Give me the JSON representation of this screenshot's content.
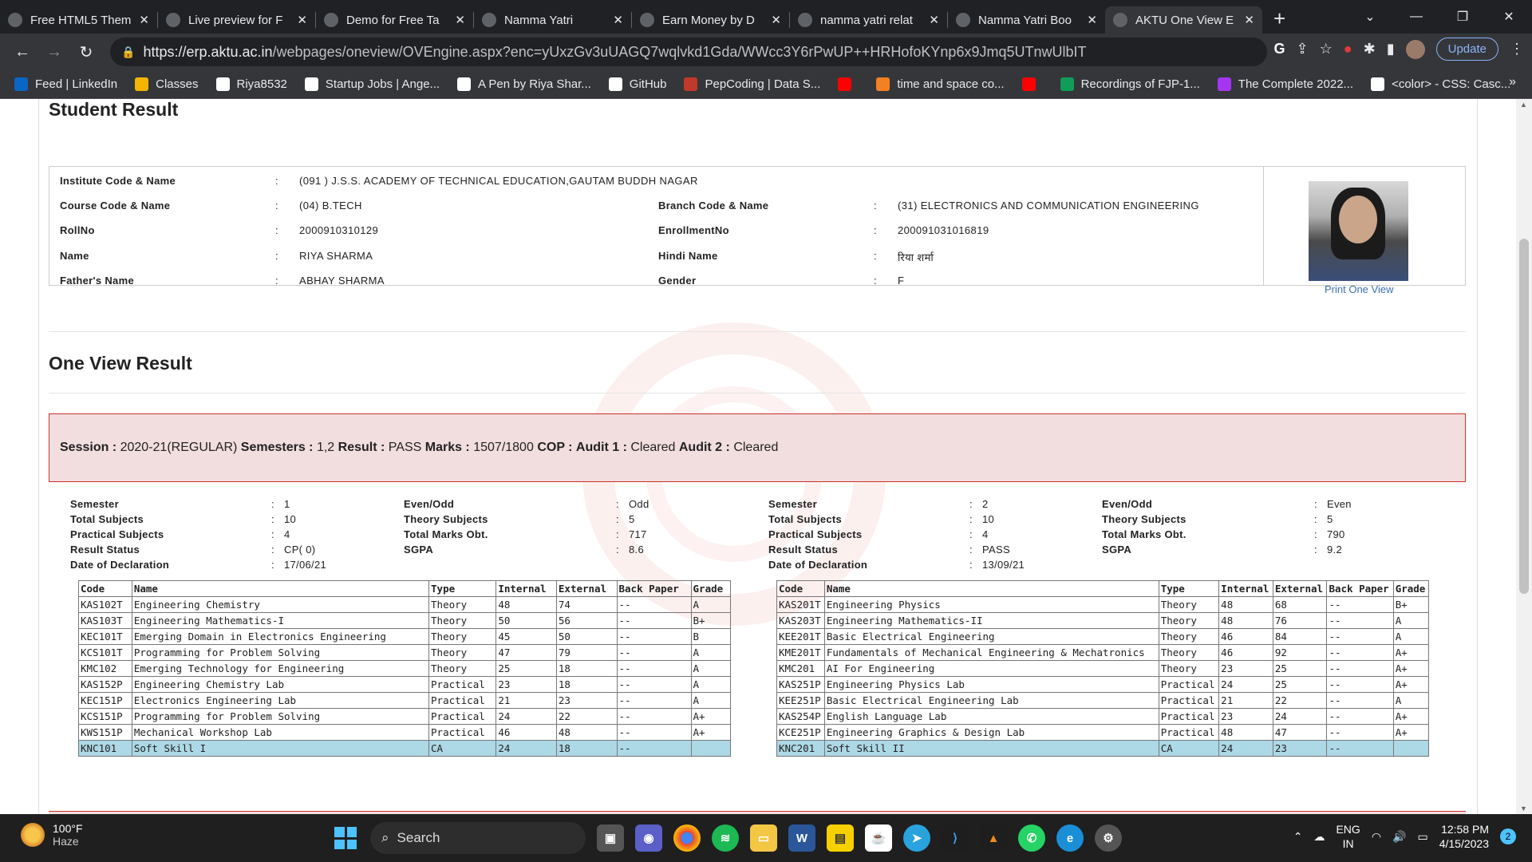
{
  "browser": {
    "tabs": [
      {
        "title": "Free HTML5 Them",
        "icon": "theme-icon",
        "active": false
      },
      {
        "title": "Live preview for F",
        "icon": "theme-icon",
        "active": false
      },
      {
        "title": "Demo for Free Ta",
        "icon": "theme-icon",
        "active": false
      },
      {
        "title": "Namma Yatri",
        "icon": "loading-icon",
        "active": false
      },
      {
        "title": "Earn Money by D",
        "icon": "page-icon",
        "active": false
      },
      {
        "title": "namma yatri relat",
        "icon": "google-icon",
        "active": false
      },
      {
        "title": "Namma Yatri Boo",
        "icon": "globe-icon",
        "active": false
      },
      {
        "title": "AKTU One View E",
        "icon": "aktu-icon",
        "active": true
      }
    ],
    "url_host": "https://erp.aktu.ac.in",
    "url_path": "/webpages/oneview/OVEngine.aspx?enc=yUxzGv3uUAGQ7wqlvkd1Gda/WWcc3Y6rPwUP++HRHofoKYnp6x9Jmq5UTnwUlbIT",
    "update_label": "Update",
    "bookmarks": [
      {
        "label": "Feed | LinkedIn",
        "icon": "linkedin-icon",
        "color": "#0a66c2"
      },
      {
        "label": "Classes",
        "icon": "classroom-icon",
        "color": "#f4b400"
      },
      {
        "label": "Riya8532",
        "icon": "github-icon",
        "color": "#ffffff"
      },
      {
        "label": "Startup Jobs | Ange...",
        "icon": "angellist-icon",
        "color": "#ffffff"
      },
      {
        "label": "A Pen by Riya Shar...",
        "icon": "codepen-icon",
        "color": "#ffffff"
      },
      {
        "label": "GitHub",
        "icon": "github-icon",
        "color": "#ffffff"
      },
      {
        "label": "PepCoding | Data S...",
        "icon": "pepcoding-icon",
        "color": "#c0392b"
      },
      {
        "label": "",
        "icon": "youtube-icon",
        "color": "#ff0000"
      },
      {
        "label": "time and space co...",
        "icon": "stackoverflow-icon",
        "color": "#f48024"
      },
      {
        "label": "",
        "icon": "youtube-icon",
        "color": "#ff0000"
      },
      {
        "label": "Recordings of FJP-1...",
        "icon": "sheets-icon",
        "color": "#0f9d58"
      },
      {
        "label": "The Complete 2022...",
        "icon": "udemy-icon",
        "color": "#a435f0"
      },
      {
        "label": "<color> - CSS: Casc...",
        "icon": "mdn-icon",
        "color": "#ffffff"
      }
    ]
  },
  "student": {
    "section_title": "Student Result",
    "institute_label": "Institute Code & Name",
    "institute_value": "(091 ) J.S.S. ACADEMY OF TECHNICAL EDUCATION,GAUTAM BUDDH NAGAR",
    "course_label": "Course Code & Name",
    "course_value": "(04) B.TECH",
    "branch_label": "Branch Code & Name",
    "branch_value": "(31) ELECTRONICS AND COMMUNICATION ENGINEERING",
    "roll_label": "RollNo",
    "roll_value": "2000910310129",
    "enroll_label": "EnrollmentNo",
    "enroll_value": "200091031016819",
    "name_label": "Name",
    "name_value": "RIYA SHARMA",
    "hindi_label": "Hindi Name",
    "hindi_value": "रिया शर्मा",
    "father_label": "Father's Name",
    "father_value": "ABHAY SHARMA",
    "gender_label": "Gender",
    "gender_value": "F",
    "print_link": "Print One View"
  },
  "oneview": {
    "title": "One View Result",
    "session_label": "Session :",
    "session_value": "2020-21(REGULAR)",
    "semesters_label": "Semesters :",
    "semesters_value": "1,2",
    "result_label": "Result :",
    "result_value": "PASS",
    "marks_label": "Marks :",
    "marks_value": "1507/1800",
    "cop_label": "COP :",
    "audit1_label": "Audit 1 :",
    "audit1_value": "Cleared",
    "audit2_label": "Audit 2 :",
    "audit2_value": "Cleared"
  },
  "semester_labels": {
    "semester": "Semester",
    "total_subjects": "Total Subjects",
    "practical_subjects": "Practical Subjects",
    "result_status": "Result Status",
    "date_of_declaration": "Date of Declaration",
    "even_odd": "Even/Odd",
    "theory_subjects": "Theory Subjects",
    "total_marks": "Total Marks Obt.",
    "sgpa": "SGPA"
  },
  "semesters": [
    {
      "semester": "1",
      "total_subjects": "10",
      "practical_subjects": "4",
      "result_status": "CP( 0)",
      "date": "17/06/21",
      "even_odd": "Odd",
      "theory_subjects": "5",
      "total_marks": "717",
      "sgpa": "8.6"
    },
    {
      "semester": "2",
      "total_subjects": "10",
      "practical_subjects": "4",
      "result_status": "PASS",
      "date": "13/09/21",
      "even_odd": "Even",
      "theory_subjects": "5",
      "total_marks": "790",
      "sgpa": "9.2"
    }
  ],
  "table_headers": [
    "Code",
    "Name",
    "Type",
    "Internal",
    "External",
    "Back Paper",
    "Grade"
  ],
  "sem1_rows": [
    [
      "KAS102T",
      "Engineering Chemistry",
      "Theory",
      "48",
      "74",
      "--",
      "A"
    ],
    [
      "KAS103T",
      "Engineering Mathematics-I",
      "Theory",
      "50",
      "56",
      "--",
      "B+"
    ],
    [
      "KEC101T",
      "Emerging Domain in Electronics Engineering",
      "Theory",
      "45",
      "50",
      "--",
      "B"
    ],
    [
      "KCS101T",
      "Programming for Problem Solving",
      "Theory",
      "47",
      "79",
      "--",
      "A"
    ],
    [
      "KMC102",
      "Emerging Technology for Engineering",
      "Theory",
      "25",
      "18",
      "--",
      "A"
    ],
    [
      "KAS152P",
      "Engineering Chemistry Lab",
      "Practical",
      "23",
      "18",
      "--",
      "A"
    ],
    [
      "KEC151P",
      "Electronics Engineering Lab",
      "Practical",
      "21",
      "23",
      "--",
      "A"
    ],
    [
      "KCS151P",
      "Programming for Problem Solving",
      "Practical",
      "24",
      "22",
      "--",
      "A+"
    ],
    [
      "KWS151P",
      "Mechanical Workshop Lab",
      "Practical",
      "46",
      "48",
      "--",
      "A+"
    ],
    [
      "KNC101",
      "Soft Skill I",
      "CA",
      "24",
      "18",
      "--",
      ""
    ]
  ],
  "sem2_rows": [
    [
      "KAS201T",
      "Engineering Physics",
      "Theory",
      "48",
      "68",
      "--",
      "B+"
    ],
    [
      "KAS203T",
      "Engineering Mathematics-II",
      "Theory",
      "48",
      "76",
      "--",
      "A"
    ],
    [
      "KEE201T",
      "Basic Electrical Engineering",
      "Theory",
      "46",
      "84",
      "--",
      "A"
    ],
    [
      "KME201T",
      "Fundamentals of Mechanical Engineering & Mechatronics",
      "Theory",
      "46",
      "92",
      "--",
      "A+"
    ],
    [
      "KMC201",
      "AI For Engineering",
      "Theory",
      "23",
      "25",
      "--",
      "A+"
    ],
    [
      "KAS251P",
      "Engineering Physics Lab",
      "Practical",
      "24",
      "25",
      "--",
      "A+"
    ],
    [
      "KEE251P",
      "Basic Electrical Engineering Lab",
      "Practical",
      "21",
      "22",
      "--",
      "A"
    ],
    [
      "KAS254P",
      "English Language Lab",
      "Practical",
      "23",
      "24",
      "--",
      "A+"
    ],
    [
      "KCE251P",
      "Engineering Graphics & Design Lab",
      "Practical",
      "48",
      "47",
      "--",
      "A+"
    ],
    [
      "KNC201",
      "Soft Skill II",
      "CA",
      "24",
      "23",
      "--",
      ""
    ]
  ],
  "taskbar": {
    "temperature": "100°F",
    "weather": "Haze",
    "search_label": "Search",
    "lang_top": "ENG",
    "lang_bottom": "IN",
    "time": "12:58 PM",
    "date": "4/15/2023",
    "notification_count": "2"
  }
}
